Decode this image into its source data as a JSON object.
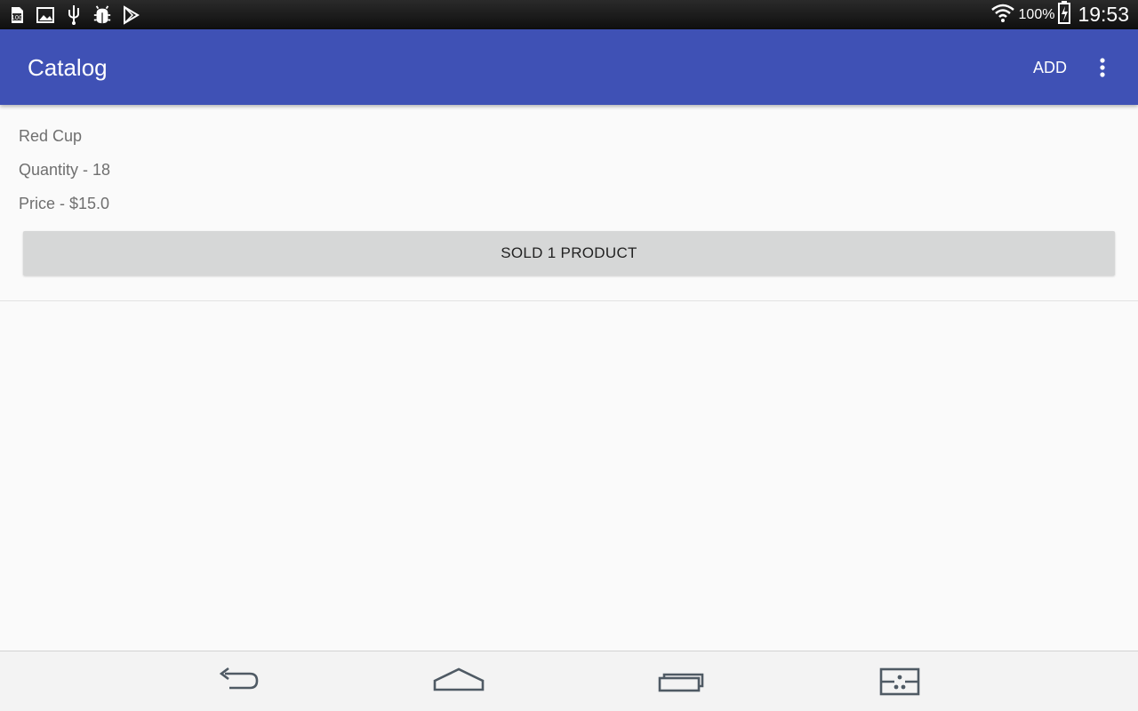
{
  "status_bar": {
    "left_icons": [
      "storage-100-icon",
      "gallery-icon",
      "usb-icon",
      "android-debug-icon",
      "play-store-icon"
    ],
    "wifi_icon": "wifi-icon",
    "battery_percent": "100%",
    "battery_icon": "battery-charging-icon",
    "time": "19:53"
  },
  "app_bar": {
    "title": "Catalog",
    "add_label": "ADD",
    "overflow_icon": "more-vert-icon",
    "color": "#3f51b5"
  },
  "products": [
    {
      "name": "Red Cup",
      "quantity": "Quantity - 18",
      "price": "Price - $15.0",
      "sold_button_label": "SOLD 1 PRODUCT"
    }
  ],
  "nav_bar": {
    "buttons": [
      "back-icon",
      "home-icon",
      "recent-apps-icon",
      "qslide-icon"
    ]
  }
}
